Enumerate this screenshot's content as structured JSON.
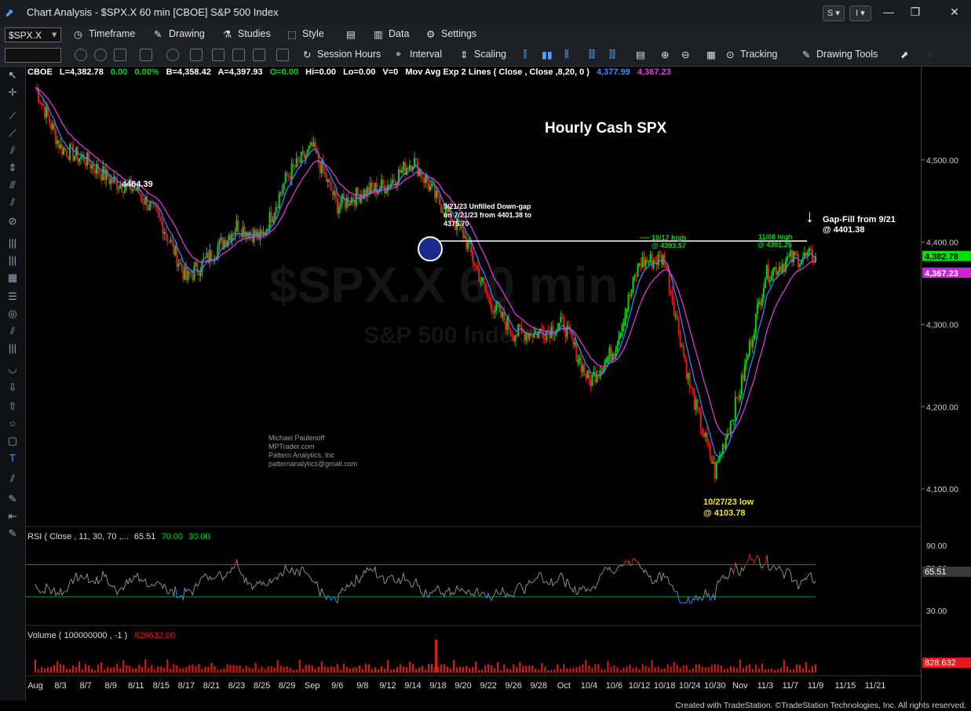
{
  "window": {
    "title": "Chart Analysis - $SPX.X 60 min [CBOE] S&P 500 Index",
    "btn_s": "S ▾",
    "btn_i": "I ▾"
  },
  "toolbar1": {
    "symbol": "$SPX.X",
    "timeframe": "Timeframe",
    "drawing": "Drawing",
    "studies": "Studies",
    "style": "Style",
    "data": "Data",
    "settings": "Settings"
  },
  "toolbar2": {
    "session_hours": "Session Hours",
    "interval": "Interval",
    "scaling": "Scaling",
    "tracking": "Tracking",
    "drawing_tools": "Drawing Tools"
  },
  "info_line": {
    "exchange": "CBOE",
    "last": "L=4,382.78",
    "change": "0.00",
    "change_pct": "0.00%",
    "bid": "B=4,358.42",
    "ask": "A=4,397.93",
    "open": "O=0.00",
    "hi": "Hi=0.00",
    "lo": "Lo=0.00",
    "vol": "V=0",
    "study": "Mov Avg Exp 2 Lines ( Close , Close ,8,20, 0 )",
    "ma1": "4,377.99",
    "ma2": "4,367.23"
  },
  "colors": {
    "up": "#00d21e",
    "down": "#e11a1a",
    "ma_fast": "#3f8cff",
    "ma_slow": "#e040e0",
    "rsi": "#8c8c8c",
    "rsi_ob": "#e11a1a",
    "rsi_os": "#1e8cff",
    "last_bg": "#00e000",
    "ma_bg": "#d11fd1"
  },
  "annotations": {
    "title": "Hourly Cash SPX",
    "low_4464": "4464.39",
    "gap_note_1": "9/21/23 Unfilled Down-gap",
    "gap_note_2": "on 7/21/23 from 4401.38 to",
    "gap_note_3": "4375.70",
    "gap_fill_1": "Gap-Fill from 9/21",
    "gap_fill_2": "@ 4401.38",
    "high_1017_1": "10/17 high",
    "high_1017_2": "@ 4393.57",
    "high_1108_1": "11/08 high",
    "high_1108_2": "@ 4391.20",
    "low_1027_1": "10/27/23 low",
    "low_1027_2": "@ 4103.78",
    "author_1": "Michael Paulenoff",
    "author_2": "MPTrader.com",
    "author_3": "Pattern Analytics, Inc",
    "author_4": "patternanalytics@gmail.com",
    "watermark_1": "$SPX.X 60 min",
    "watermark_2": "S&P 500 Index"
  },
  "rsi": {
    "label": "RSI (  Close ,  11,  30,  70 ,...",
    "value": "65.51",
    "ob": "70.00",
    "os": "30.00",
    "axis": [
      "90.00",
      "70.00",
      "30.00"
    ],
    "last": "65.51"
  },
  "volume": {
    "label": "Volume ( 100000000 , -1 )",
    "value": "828632.00",
    "last": "828.632"
  },
  "price_axis": {
    "ticks": [
      "4,500.00",
      "4,400.00",
      "4,300.00",
      "4,200.00",
      "4,100.00"
    ],
    "last": "4,382.78",
    "ma": "4,367.23"
  },
  "status": {
    "copyright": "Created with TradeStation. ©TradeStation Technologies, Inc. All rights reserved."
  },
  "chart_data": {
    "type": "line",
    "title": "Hourly Cash SPX",
    "ylim": [
      4060,
      4600
    ],
    "x_ticks": [
      "Aug",
      "8/3",
      "8/7",
      "8/9",
      "8/11",
      "8/15",
      "8/17",
      "8/21",
      "8/23",
      "8/25",
      "8/29",
      "Sep",
      "9/6",
      "9/8",
      "9/12",
      "9/14",
      "9/18",
      "9/20",
      "9/22",
      "9/26",
      "9/28",
      "Oct",
      "10/4",
      "10/6",
      "10/12",
      "10/18",
      "10/24",
      "10/30",
      "Nov",
      "11/3",
      "11/7",
      "11/9",
      "11/15",
      "11/21"
    ],
    "series": [
      {
        "name": "S&P 500 Index",
        "x": [
          "Aug",
          "8/3",
          "8/7",
          "8/9",
          "8/11",
          "8/15",
          "8/17",
          "8/21",
          "8/23",
          "8/25",
          "8/29",
          "Sep",
          "9/6",
          "9/8",
          "9/12",
          "9/14",
          "9/18",
          "9/20",
          "9/22",
          "9/26",
          "9/28",
          "Oct",
          "10/4",
          "10/6",
          "10/12",
          "10/18",
          "10/24",
          "10/30",
          "Nov",
          "11/3",
          "11/7",
          "11/9"
        ],
        "values": [
          4588,
          4515,
          4500,
          4475,
          4464,
          4425,
          4355,
          4385,
          4420,
          4405,
          4480,
          4515,
          4445,
          4460,
          4470,
          4500,
          4450,
          4410,
          4330,
          4290,
          4290,
          4300,
          4230,
          4270,
          4375,
          4380,
          4225,
          4120,
          4220,
          4360,
          4380,
          4382.78
        ]
      }
    ],
    "levels": [
      {
        "label": "Gap-Fill from 9/21 @ 4401.38",
        "value": 4401.38
      },
      {
        "label": "10/17 high @ 4393.57",
        "value": 4393.57
      },
      {
        "label": "11/08 high @ 4391.20",
        "value": 4391.2
      },
      {
        "label": "10/27/23 low @ 4103.78",
        "value": 4103.78
      },
      {
        "label": "4464.39",
        "value": 4464.39
      }
    ],
    "rsi_ylim": [
      0,
      100
    ],
    "volume_last": 828632
  }
}
